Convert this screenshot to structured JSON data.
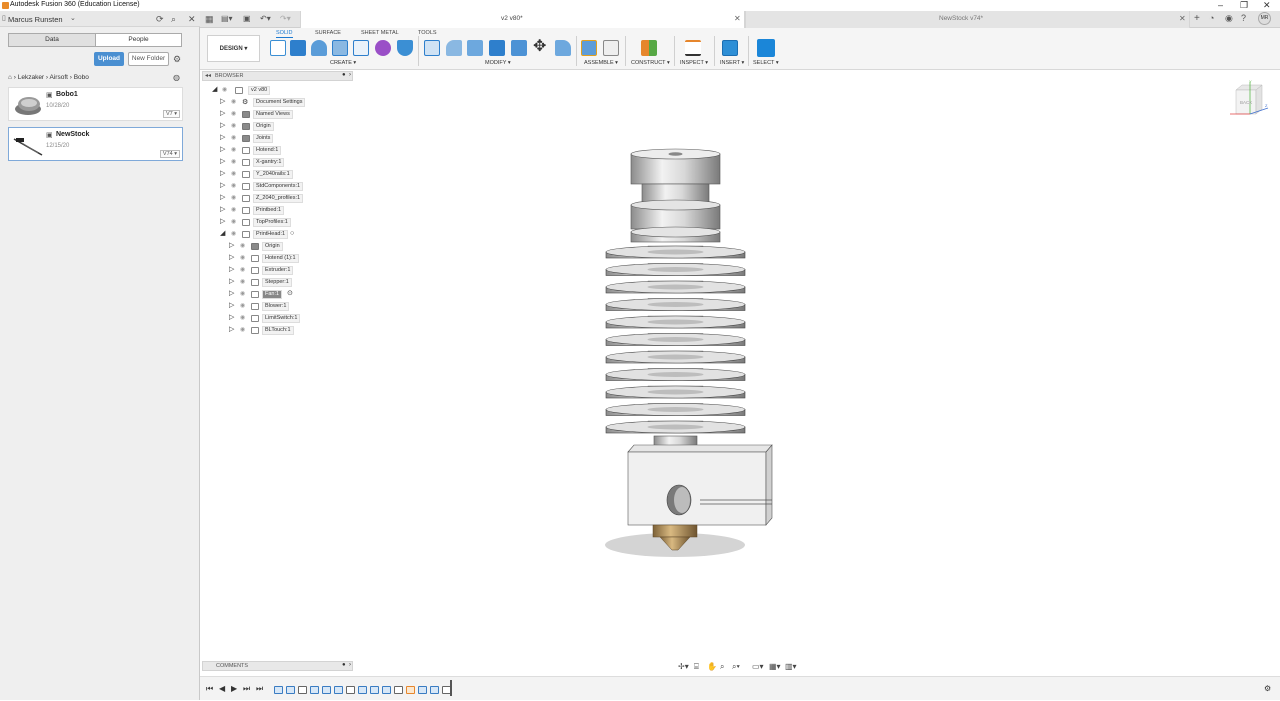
{
  "window": {
    "title": "Autodesk Fusion 360 (Education License)",
    "min": "–",
    "max": "❐",
    "close": "✕"
  },
  "data_panel": {
    "user": "Marcus Runsten",
    "tabs": [
      "Data",
      "People"
    ],
    "upload": "Upload",
    "new_folder": "New Folder",
    "breadcrumb": [
      "Lekzaker",
      "Airsoft",
      "Bobo"
    ],
    "files": [
      {
        "name": "Bobo1",
        "date": "10/28/20",
        "version": "V7 ▾"
      },
      {
        "name": "NewStock",
        "date": "12/15/20",
        "version": "V74 ▾"
      }
    ]
  },
  "doc_tabs": [
    {
      "label": "v2 v80*",
      "active": true
    },
    {
      "label": "NewStock v74*",
      "active": false
    }
  ],
  "user_initials": "MR",
  "workspace_tabs": [
    "SOLID",
    "SURFACE",
    "SHEET METAL",
    "TOOLS"
  ],
  "design_menu": "DESIGN ▾",
  "toolbar_groups": [
    "CREATE ▾",
    "MODIFY ▾",
    "ASSEMBLE ▾",
    "CONSTRUCT ▾",
    "INSPECT ▾",
    "INSERT ▾",
    "SELECT ▾"
  ],
  "browser": {
    "title": "BROWSER",
    "root": "v2 v80",
    "items": [
      {
        "label": "Document Settings",
        "level": 1,
        "icon": "gear"
      },
      {
        "label": "Named Views",
        "level": 1,
        "icon": "folder"
      },
      {
        "label": "Origin",
        "level": 1,
        "icon": "folder"
      },
      {
        "label": "Joints",
        "level": 1,
        "icon": "folder"
      },
      {
        "label": "Hotend:1",
        "level": 1,
        "icon": "component"
      },
      {
        "label": "X-gantry:1",
        "level": 1,
        "icon": "component"
      },
      {
        "label": "Y_2040rails:1",
        "level": 1,
        "icon": "component"
      },
      {
        "label": "StdComponents:1",
        "level": 1,
        "icon": "component"
      },
      {
        "label": "Z_2040_profiles:1",
        "level": 1,
        "icon": "component"
      },
      {
        "label": "Printbed:1",
        "level": 1,
        "icon": "component"
      },
      {
        "label": "TopProfiles:1",
        "level": 1,
        "icon": "component"
      },
      {
        "label": "PrintHead:1",
        "level": 1,
        "icon": "component",
        "expanded": true
      },
      {
        "label": "Origin",
        "level": 2,
        "icon": "folder"
      },
      {
        "label": "Hotend (1):1",
        "level": 2,
        "icon": "component"
      },
      {
        "label": "Extruder:1",
        "level": 2,
        "icon": "component"
      },
      {
        "label": "Stepper:1",
        "level": 2,
        "icon": "component"
      },
      {
        "label": "Fan:1",
        "level": 2,
        "icon": "component",
        "highlight": true
      },
      {
        "label": "Blower:1",
        "level": 2,
        "icon": "component"
      },
      {
        "label": "LimitSwitch:1",
        "level": 2,
        "icon": "component"
      },
      {
        "label": "BLTouch:1",
        "level": 2,
        "icon": "component"
      }
    ]
  },
  "comments": "COMMENTS",
  "viewcube": {
    "face": "BACK",
    "axis_x": "X",
    "axis_y": "Y",
    "axis_z": "Z"
  }
}
